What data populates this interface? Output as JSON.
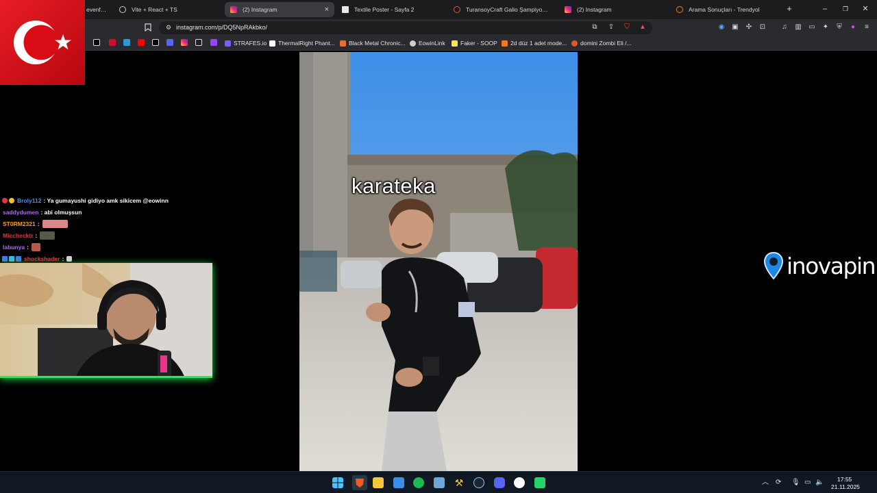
{
  "browser": {
    "tabs": [
      {
        "label": "evenfold",
        "favicon": "generic-icon"
      },
      {
        "label": "Vite + React + TS",
        "favicon": "globe-icon"
      },
      {
        "label": "(2) Instagram",
        "favicon": "instagram-icon",
        "active": true
      },
      {
        "label": "Textile Poster - Sayfa 2",
        "favicon": "document-icon"
      },
      {
        "label": "TuransoyCraft Galio Şampiyon Boyal",
        "favicon": "turansoy-icon"
      },
      {
        "label": "(2) Instagram",
        "favicon": "instagram-icon"
      },
      {
        "label": "Arama Sonuçları - Trendyol",
        "favicon": "trendyol-icon"
      }
    ],
    "new_tab_label": "+",
    "window_controls": {
      "minimize": "–",
      "restore": "❐",
      "close": "✕"
    },
    "tab_close": "×",
    "address_bar": {
      "url": "instagram.com/p/DQ5NpRAkbko/"
    },
    "bookmarks": [
      {
        "label": "STRAFES.io",
        "color": "#7a5cff"
      },
      {
        "label": "ThermalRight Phant...",
        "color": "#ffffff"
      },
      {
        "label": "Black Metal Chronic...",
        "color": "#f06a35"
      },
      {
        "label": "EowinLink",
        "color": "#cfcfcf"
      },
      {
        "label": "Faker - SOOP",
        "color": "#ffe94a"
      },
      {
        "label": "2d düz 1 adet mode...",
        "color": "#f27a1a"
      },
      {
        "label": "domini Zombi Eli /...",
        "color": "#e0562f"
      }
    ],
    "bookmark_icons": [
      "tiktok-icon",
      "red-square-icon",
      "letterboxd-icon",
      "youtube-icon",
      "x-icon",
      "grid-icon",
      "instagram-icon",
      "kr-icon",
      "twitch-icon",
      "steam-icon"
    ]
  },
  "chat": {
    "messages": [
      {
        "user": "Broly112",
        "user_color": "#4f8cf7",
        "text": ": Ya gumayushi gidiyo amk sikicem @eowinn",
        "badges": [
          "#e8353b",
          "#f2c230"
        ]
      },
      {
        "user": "saddydumen",
        "user_color": "#b06cf2",
        "text": ": abi olmuşsun",
        "badges": []
      },
      {
        "user": "ST0RM2321",
        "user_color": "#f2a326",
        "text": ":",
        "badges": [],
        "emote": "#d9888a"
      },
      {
        "user": "Micchecktr",
        "user_color": "#e8353b",
        "text": ":",
        "badges": [],
        "emote": "#555a48"
      },
      {
        "user": "labunya",
        "user_color": "#b06cf2",
        "text": ":",
        "badges": [],
        "emote": "#b25c4b"
      },
      {
        "user": "shockshader",
        "user_color": "#e8353b",
        "text": ":",
        "badges": [
          "#3d7fe0",
          "#3d7fe0",
          "#3d7fe0"
        ],
        "emote": "#cfcfcf"
      }
    ]
  },
  "video": {
    "caption": "karateka"
  },
  "sponsor": {
    "name": "inovapin"
  },
  "overlay": {
    "flag": "turkish-flag"
  },
  "taskbar": {
    "apps": [
      "start-icon",
      "brave-icon",
      "folder-icon",
      "photos-icon",
      "spotify-icon",
      "vpn-icon",
      "tool-icon",
      "steam-icon",
      "discord-icon",
      "panda-icon",
      "whatsapp-icon"
    ],
    "time": "17:55",
    "date": "21.11.2025"
  },
  "colors": {
    "accent_green": "#1fef52",
    "flag_red": "#d90c16",
    "chrome_bg": "#1c1c1f"
  }
}
